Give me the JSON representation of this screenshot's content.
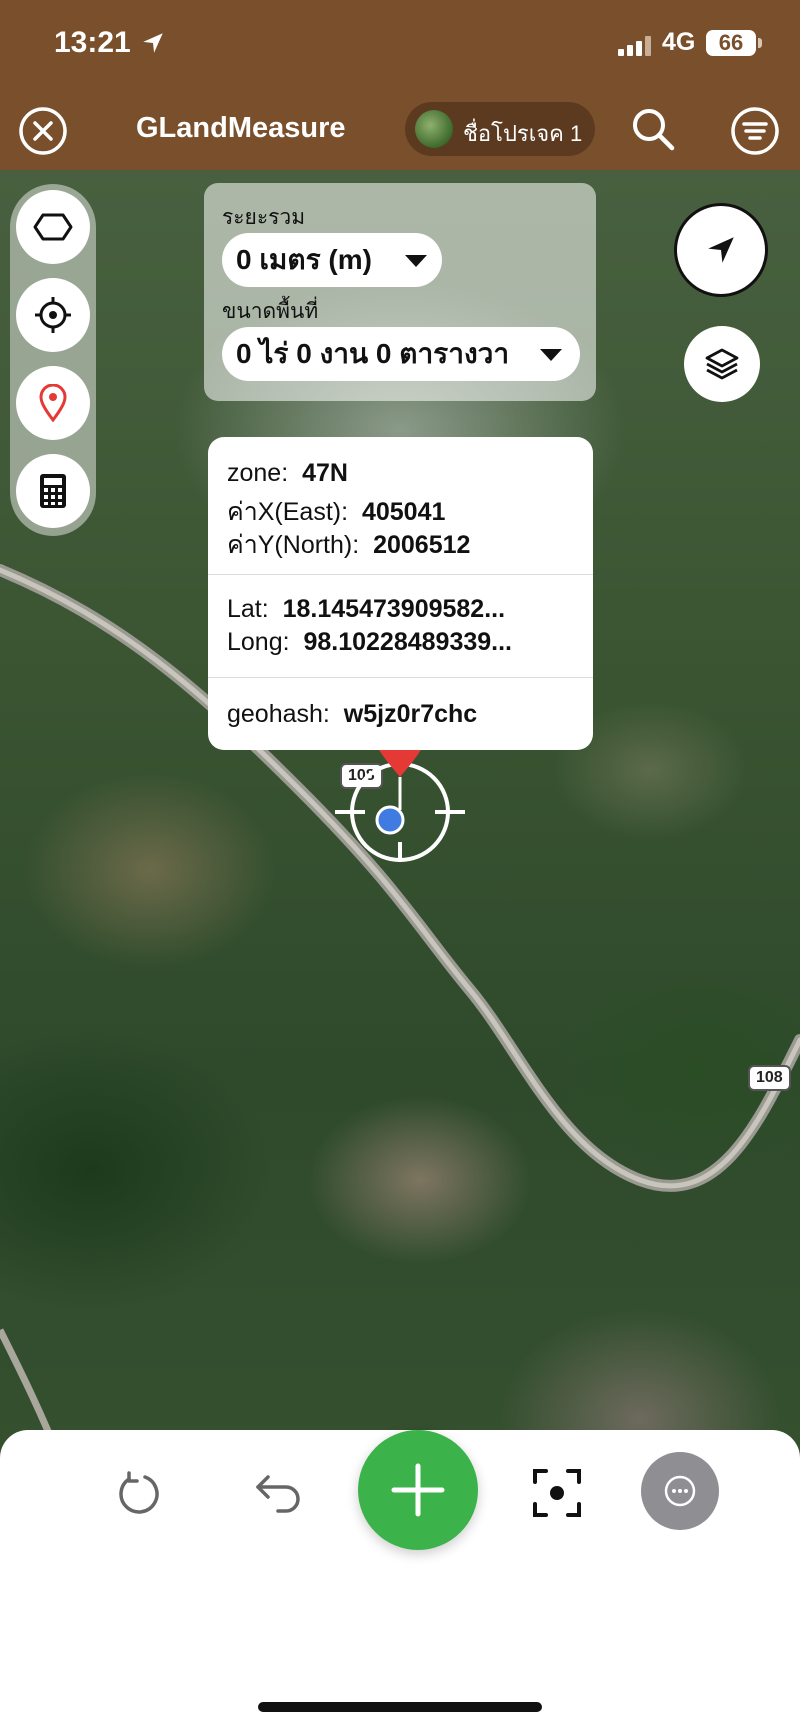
{
  "status_bar": {
    "time": "13:21",
    "network": "4G",
    "battery": "66"
  },
  "app_bar": {
    "title": "GLandMeasure",
    "project_name": "ชื่อโปรเจค 1"
  },
  "measure": {
    "distance_label": "ระยะรวม",
    "distance_value": "0 เมตร (m)",
    "area_label": "ขนาดพื้นที่",
    "area_value": "0 ไร่ 0 งาน 0 ตารางวา"
  },
  "coords": {
    "zone_label": "zone:",
    "zone_value": "47N",
    "x_label": "ค่าX(East):",
    "x_value": "405041",
    "y_label": "ค่าY(North):",
    "y_value": "2006512",
    "lat_label": "Lat:",
    "lat_value": "18.145473909582...",
    "long_label": "Long:",
    "long_value": "98.10228489339...",
    "geohash_label": "geohash:",
    "geohash_value": "w5jz0r7chc"
  },
  "map": {
    "road_labels": [
      "108",
      "108"
    ]
  },
  "colors": {
    "brand_brown": "#7a4f2b",
    "add_green": "#3bb34a",
    "pin_red": "#e53935",
    "location_blue": "#3f7be0"
  },
  "icons": {
    "tools": [
      "polygon-icon",
      "crosshair-icon",
      "pin-icon",
      "calculator-icon"
    ],
    "bottom": [
      "refresh-icon",
      "undo-icon",
      "add-icon",
      "focus-icon",
      "more-icon"
    ]
  }
}
